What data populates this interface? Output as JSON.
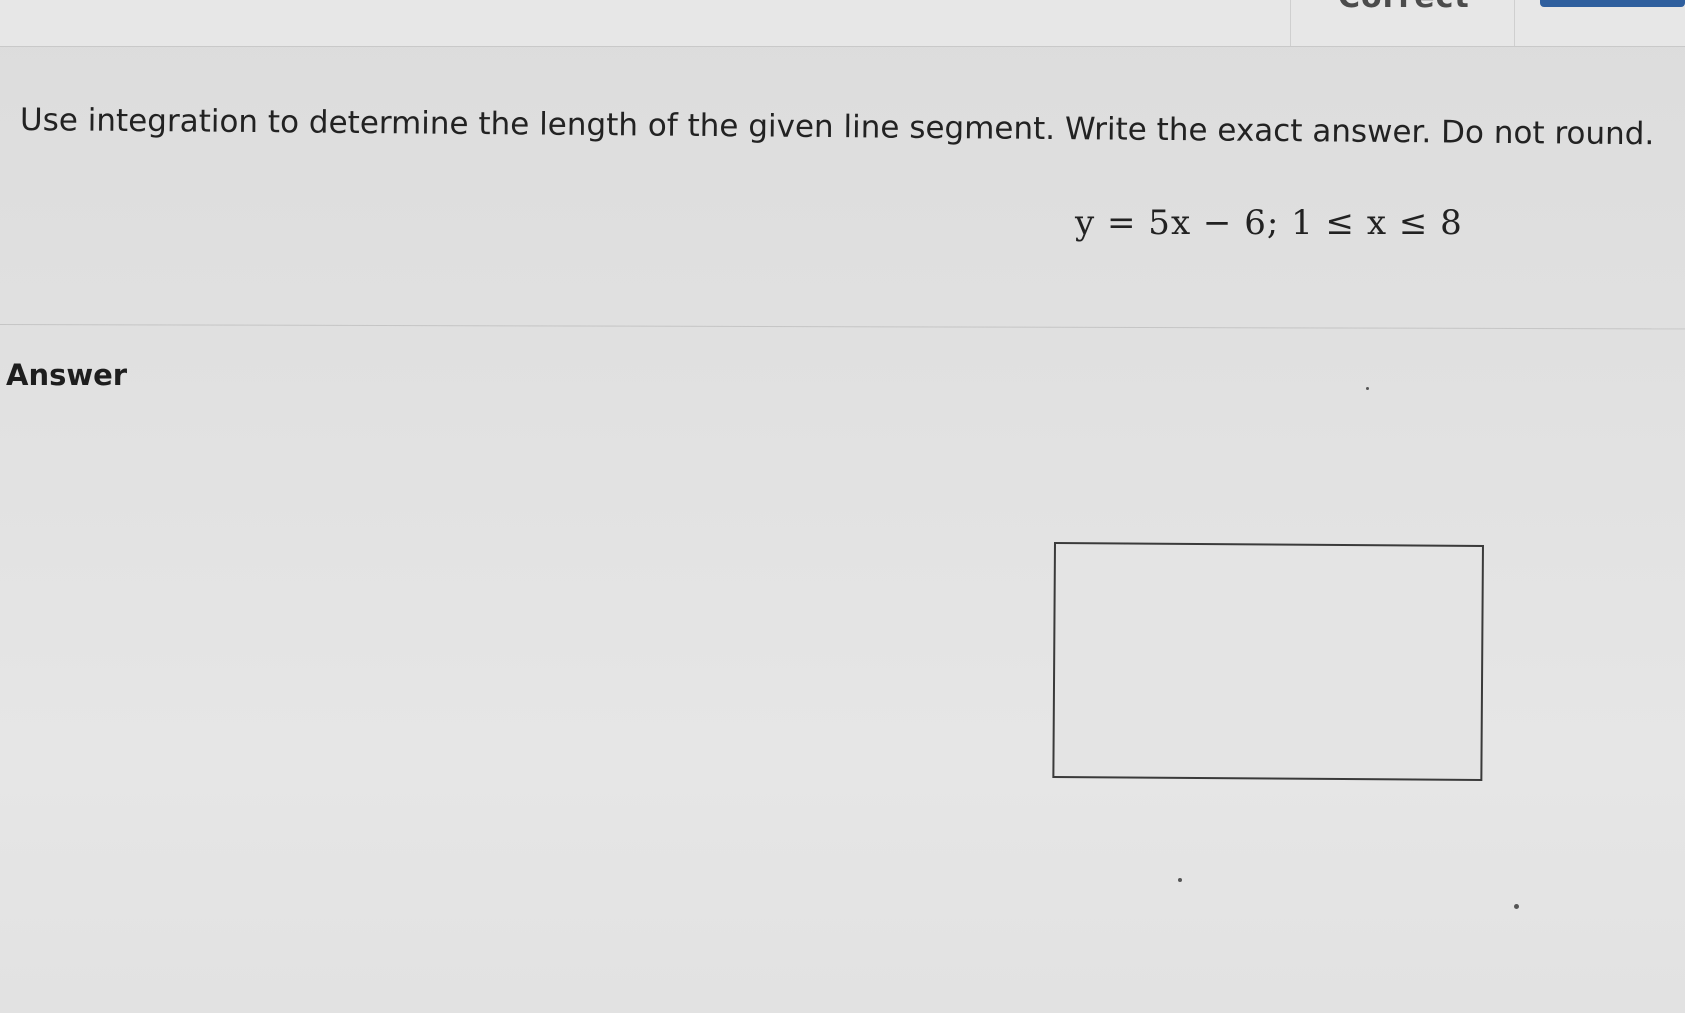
{
  "header": {
    "status_text": "Correct"
  },
  "question": {
    "prompt": "Use integration to determine the length of the given line segment. Write the exact answer. Do not round.",
    "equation": "y = 5x − 6; 1 ≤ x ≤ 8"
  },
  "answer": {
    "label": "Answer",
    "value": ""
  }
}
